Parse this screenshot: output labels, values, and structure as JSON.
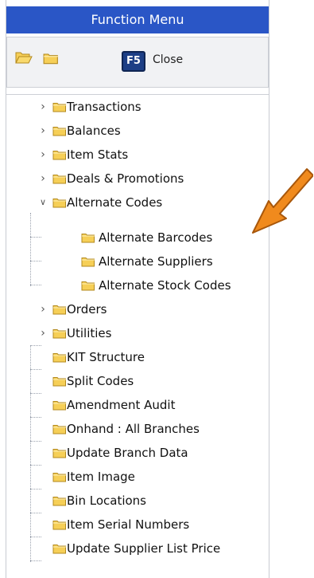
{
  "title": "Function Menu",
  "toolbar": {
    "f5_key": "F5",
    "close_label": "Close"
  },
  "tree": {
    "items": [
      {
        "label": "Transactions"
      },
      {
        "label": "Balances"
      },
      {
        "label": "Item Stats"
      },
      {
        "label": "Deals & Promotions"
      },
      {
        "label": "Alternate Codes"
      },
      {
        "label": "Alternate Barcodes"
      },
      {
        "label": "Alternate Suppliers"
      },
      {
        "label": "Alternate Stock Codes"
      },
      {
        "label": "Orders"
      },
      {
        "label": "Utilities"
      },
      {
        "label": "KIT Structure"
      },
      {
        "label": "Split Codes"
      },
      {
        "label": "Amendment Audit"
      },
      {
        "label": "Onhand : All Branches"
      },
      {
        "label": "Update Branch Data"
      },
      {
        "label": "Item Image"
      },
      {
        "label": "Bin Locations"
      },
      {
        "label": "Item Serial Numbers"
      },
      {
        "label": "Update Supplier List Price"
      }
    ]
  },
  "colors": {
    "title_bar": "#2a56c6",
    "folder": "#f5c94a",
    "callout_arrow": "#f08a1d"
  }
}
